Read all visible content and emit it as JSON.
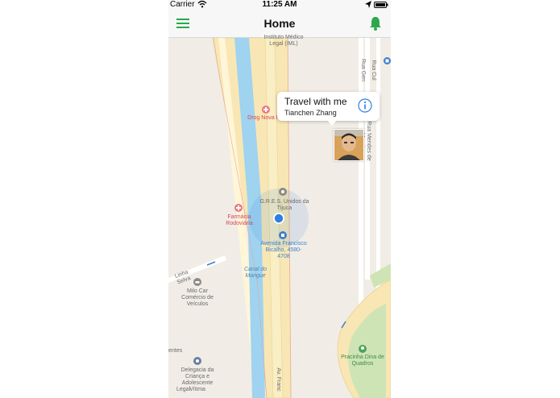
{
  "status_bar": {
    "carrier": "Carrier",
    "time": "11:25 AM"
  },
  "nav": {
    "title": "Home",
    "menu_icon": "hamburger-menu-icon",
    "bell_icon": "bell-icon",
    "accent_color": "#2ba84a"
  },
  "map": {
    "labels": {
      "instituto": "Instituto Médico Legal (IML)",
      "drog": "Drog Nova F",
      "gres": "G.R.E.S. Unidos da Tijuca",
      "farmacia": "Farmácia Rodoviária",
      "avenida": "Avenida Francisco Bicalho, 4580-4708",
      "canal": "Canal do Mangue",
      "milo": "Milo Car Comércio de Veículos",
      "linha": "Linha Selva",
      "delegacia": "Delegacia da Criança e Adolescente Vítima",
      "pracinha": "Pracinha Dina de Quadros",
      "av_franc": "Av. Franc",
      "rua_mendes": "Rua Mendes de Morais",
      "rua_gen": "Rua Gen",
      "rua_cul": "Rua Cul",
      "legal": "Legal",
      "entes": "entes"
    },
    "user_location_color": "#2f7fe0"
  },
  "callout": {
    "title": "Travel with me",
    "subtitle": "Tianchen Zhang",
    "info_icon": "info-icon"
  }
}
